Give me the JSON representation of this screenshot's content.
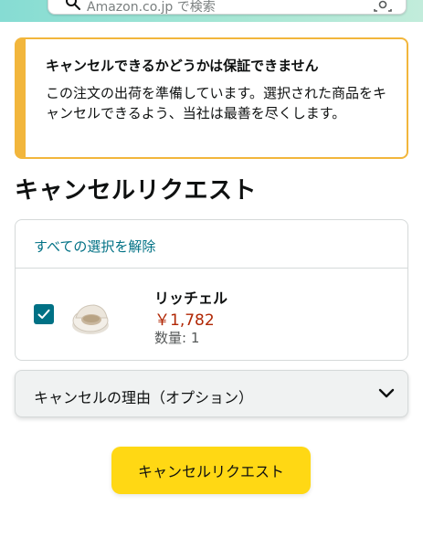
{
  "header": {
    "back_icon": "back-arrow-icon",
    "search_text": "Amazon.co.jp で検索",
    "search_icon": "search-icon",
    "lens_icon": "camera-lens-icon",
    "gradient_colors": [
      "#86dcd3",
      "#c2ecdb"
    ]
  },
  "alert": {
    "title": "キャンセルできるかどうかは保証できません",
    "body": "この注文の出荷を準備しています。選択された商品をキャンセルできるよう、当社は最善を尽くします。",
    "accent_color": "#f2b63c"
  },
  "page_title": "キャンセルリクエスト",
  "card": {
    "deselect_all": "すべての選択を解除",
    "item": {
      "checked": true,
      "image": "cat-litter-box-image",
      "name": "リッチェル",
      "price": "￥1,782",
      "quantity": "数量: 1"
    }
  },
  "reason_select": {
    "label": "キャンセルの理由（オプション）",
    "icon": "chevron-down-icon"
  },
  "submit_button": {
    "label": "キャンセルリクエスト",
    "color": "#ffd814"
  },
  "colors": {
    "link": "#007185",
    "price": "#b12704",
    "checkbox": "#007185"
  }
}
